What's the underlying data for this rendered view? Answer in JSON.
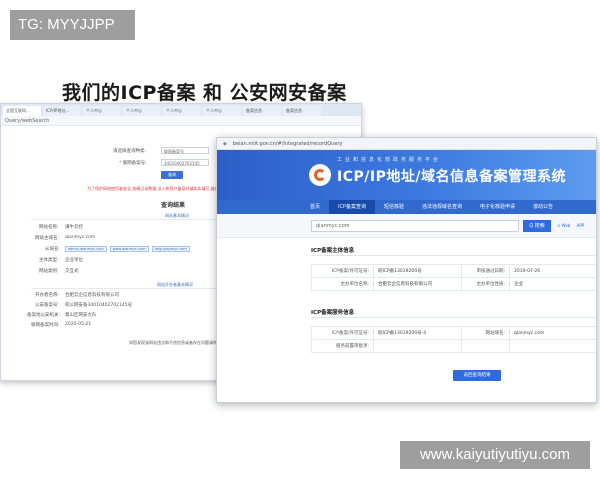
{
  "tag": "TG: MYYJJPP",
  "headline": "我们的ICP备案 和 公安网安备案",
  "back_window": {
    "tabs": [
      "全国互联网...",
      "ICP/IP地址...",
      "个人中心",
      "个人中心",
      "个人中心",
      "个人中心",
      "备案信息",
      "备案信息"
    ],
    "url": "Query/webSearch",
    "form": {
      "query_type_label": "请选择查询种类:",
      "query_type_value": "联网备案号",
      "record_no_label": "* 联网备案号:",
      "record_no_value": "34010402702145",
      "submit": "查询"
    },
    "warning": "为了保护网络使用者安全,准确记录数据,法人和用户备案时请如实填写,维护国家安全及社会稳定。",
    "result_title": "查询结果",
    "basic_info_title": "网站基本情况",
    "fields": {
      "site_name_label": "网站名称:",
      "site_name": "谦牛云控",
      "domain_label": "网站主域名:",
      "domain": "qianmyc.com",
      "subdomain_label": "从域名:",
      "subdomains": [
        "admin.qianmyc.com",
        "www.qianmyc.com",
        "help.qianmyc.com"
      ],
      "type_label": "主体类型:",
      "type": "企业单位",
      "category_label": "网站类别:",
      "category": "交互式"
    },
    "org_title": "网站开办者基本情况",
    "org_fields": {
      "org_name_label": "开办者名称:",
      "org_name": "合肥云企信息科技有限公司",
      "police_no_label": "公安备案号:",
      "police_no": "皖公网安备34010402702145号",
      "office_label": "备案地公安机关:",
      "office": "蜀山区网安大队",
      "date_label": "联网备案时间:",
      "date": "2020-05-21"
    },
    "footer_note": "如您发现该网站违法和不良信息或者存在问题请举报"
  },
  "front_window": {
    "url": "beian.miit.gov.cn/#/Integrated/recordQuery",
    "org_line": "工业和信息化部政务服务平台",
    "system_title": "ICP/IP地址/域名信息备案管理系统",
    "nav": [
      "首页",
      "ICP备案查询",
      "短信核验",
      "违法违规域名查询",
      "电子化核验申请",
      "滚动公告"
    ],
    "nav_active_index": 1,
    "search_value": "qianmyc.com",
    "search_button": "Q 搜索",
    "search_extra": [
      "⊙ Web",
      "APP"
    ],
    "subject_title": "ICP备案主体信息",
    "subject_rows": [
      [
        "ICP备案/许可证号:",
        "皖ICP备13019204号",
        "审核通过日期:",
        "2019-07-26"
      ],
      [
        "主办单位名称:",
        "合肥云企信息科技有限公司",
        "主办单位性质:",
        "企业"
      ]
    ],
    "service_title": "ICP备案服务信息",
    "service_rows": [
      [
        "ICP备案/许可证号:",
        "皖ICP备13019204号-4",
        "网站域名:",
        "qianmyc.com"
      ],
      [
        "服务前置审批项:",
        "",
        "",
        ""
      ]
    ],
    "back_button": "返回查询结果"
  },
  "watermark_url": "www.kaiyutiyutiyu.com",
  "colors": {
    "header_blue": "#2e5ec8",
    "nav_active": "#174aab",
    "button_blue": "#2f6be0",
    "warning_red": "#d83a3a"
  }
}
